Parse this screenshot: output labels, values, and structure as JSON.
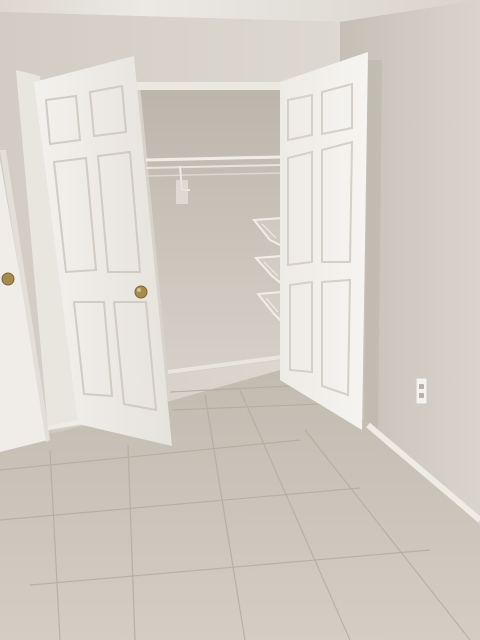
{
  "scene": {
    "subject": "empty-room-with-open-closet",
    "colors": {
      "wall": "#d7d2cb",
      "wall_shadow": "#c4bdb4",
      "closet_interior": "#cfc8bf",
      "ceiling": "#e3dfd9",
      "floor": "#cbc4ba",
      "floor_grout": "#b3ab9f",
      "door": "#f1eee9",
      "door_shade": "#d9d4cc",
      "baseboard": "#efebe5",
      "knob": "#a68a4e",
      "outlet": "#f4f2ee"
    }
  }
}
